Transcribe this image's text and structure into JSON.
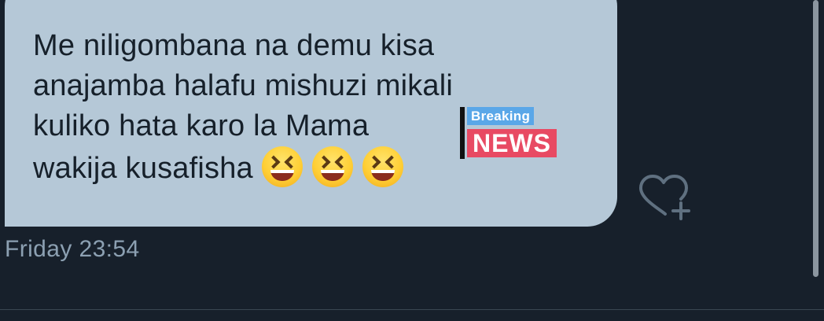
{
  "message": {
    "lines": [
      "Me niligombana na demu kisa",
      "anajamba halafu mishuzi mikali",
      "kuliko hata karo la Mama",
      "wakija kusafisha"
    ],
    "emojis": [
      "grinning-squinting-face-emoji",
      "grinning-squinting-face-emoji",
      "grinning-squinting-face-emoji"
    ],
    "sticker": {
      "top_text": "Breaking",
      "bottom_text": "NEWS",
      "colors": {
        "top": "#5aa7e8",
        "bottom": "#e84a63"
      }
    }
  },
  "timestamp": "Friday 23:54",
  "react_icon": "heart-plus-icon",
  "colors": {
    "background": "#17202b",
    "bubble": "#b5c8d7",
    "text": "#16202a",
    "timestamp": "#8ca0b2"
  }
}
